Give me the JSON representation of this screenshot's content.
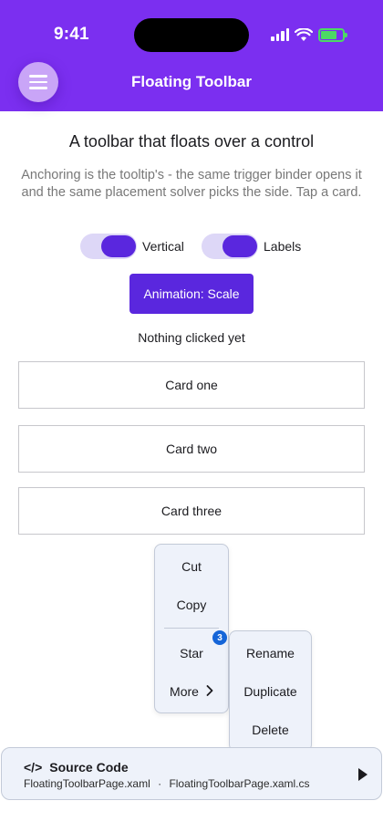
{
  "status_bar": {
    "time": "9:41"
  },
  "header": {
    "title": "Floating Toolbar",
    "menu_icon": "hamburger-icon"
  },
  "main": {
    "heading": "A toolbar that floats over a control",
    "description": "Anchoring is the tooltip's - the same trigger binder opens it and the same placement solver picks the side. Tap a card.",
    "toggles": [
      {
        "label": "Vertical",
        "on": true
      },
      {
        "label": "Labels",
        "on": true
      }
    ],
    "animation_button": "Animation: Scale",
    "status_text": "Nothing clicked yet",
    "cards": [
      "Card one",
      "Card two",
      "Card three"
    ]
  },
  "toolbar": {
    "items": [
      "Cut",
      "Copy",
      "Star",
      "More"
    ],
    "badge": "3",
    "more_icon": "chevron-right-icon",
    "submenu": [
      "Rename",
      "Duplicate",
      "Delete"
    ]
  },
  "source_code": {
    "icon": "</>",
    "title": "Source Code",
    "file_1": "FloatingToolbarPage.xaml",
    "separator": "·",
    "file_2": "FloatingToolbarPage.xaml.cs"
  },
  "colors": {
    "header": "#7b2ff0",
    "accent": "#5a27de",
    "toggle_track": "#ddd7f7",
    "badge": "#1565d8",
    "surface": "#eef2fa"
  }
}
